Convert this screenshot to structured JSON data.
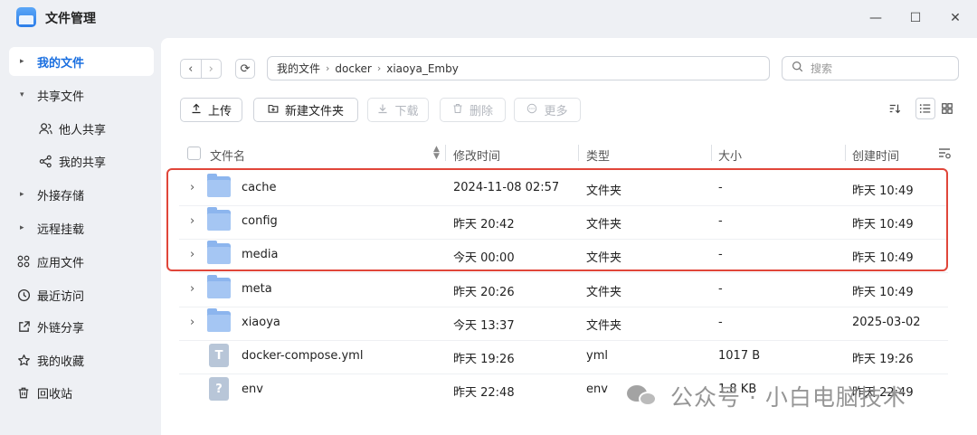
{
  "window": {
    "title": "文件管理",
    "controls": {
      "minimize": "—",
      "maximize": "☐",
      "close": "✕"
    }
  },
  "sidebar": {
    "items": [
      {
        "label": "我的文件",
        "icon": "caret-right-icon",
        "active": true
      },
      {
        "label": "共享文件",
        "icon": "caret-down-icon"
      },
      {
        "label": "他人共享",
        "icon": "people-icon",
        "sub": true
      },
      {
        "label": "我的共享",
        "icon": "share-icon",
        "sub": true
      },
      {
        "label": "外接存储",
        "icon": "caret-right-icon"
      },
      {
        "label": "远程挂载",
        "icon": "caret-right-icon"
      },
      {
        "label": "应用文件",
        "icon": "apps-icon"
      },
      {
        "label": "最近访问",
        "icon": "clock-icon"
      },
      {
        "label": "外链分享",
        "icon": "external-link-icon"
      },
      {
        "label": "我的收藏",
        "icon": "star-icon"
      },
      {
        "label": "回收站",
        "icon": "trash-icon"
      }
    ]
  },
  "toolbar": {
    "back": "‹",
    "forward": "›",
    "refresh": "⟳",
    "path": [
      "我的文件",
      "docker",
      "xiaoya_Emby"
    ],
    "path_sep": "›",
    "search_placeholder": "搜索",
    "upload": "上传",
    "new_folder": "新建文件夹",
    "download": "下载",
    "delete": "删除",
    "more": "更多"
  },
  "table": {
    "headers": {
      "name": "文件名",
      "modified": "修改时间",
      "type": "类型",
      "size": "大小",
      "created": "创建时间"
    },
    "rows": [
      {
        "name": "cache",
        "modified": "2024-11-08 02:57",
        "type": "文件夹",
        "size": "-",
        "created": "昨天 10:49",
        "kind": "folder"
      },
      {
        "name": "config",
        "modified": "昨天 20:42",
        "type": "文件夹",
        "size": "-",
        "created": "昨天 10:49",
        "kind": "folder"
      },
      {
        "name": "media",
        "modified": "今天 00:00",
        "type": "文件夹",
        "size": "-",
        "created": "昨天 10:49",
        "kind": "folder"
      },
      {
        "name": "meta",
        "modified": "昨天 20:26",
        "type": "文件夹",
        "size": "-",
        "created": "昨天 10:49",
        "kind": "folder"
      },
      {
        "name": "xiaoya",
        "modified": "今天 13:37",
        "type": "文件夹",
        "size": "-",
        "created": "2025-03-02",
        "kind": "folder"
      },
      {
        "name": "docker-compose.yml",
        "modified": "昨天 19:26",
        "type": "yml",
        "size": "1017 B",
        "created": "昨天 19:26",
        "kind": "text",
        "glyph": "T"
      },
      {
        "name": "env",
        "modified": "昨天 22:48",
        "type": "env",
        "size": "1.8 KB",
        "created": "昨天 22:49",
        "kind": "unknown",
        "glyph": "?"
      }
    ]
  },
  "watermark": {
    "text": "公众号 · 小白电脑技术"
  },
  "colors": {
    "accent": "#1a6fe0",
    "highlight": "#e0463a",
    "folder": "#a5c6f3"
  }
}
